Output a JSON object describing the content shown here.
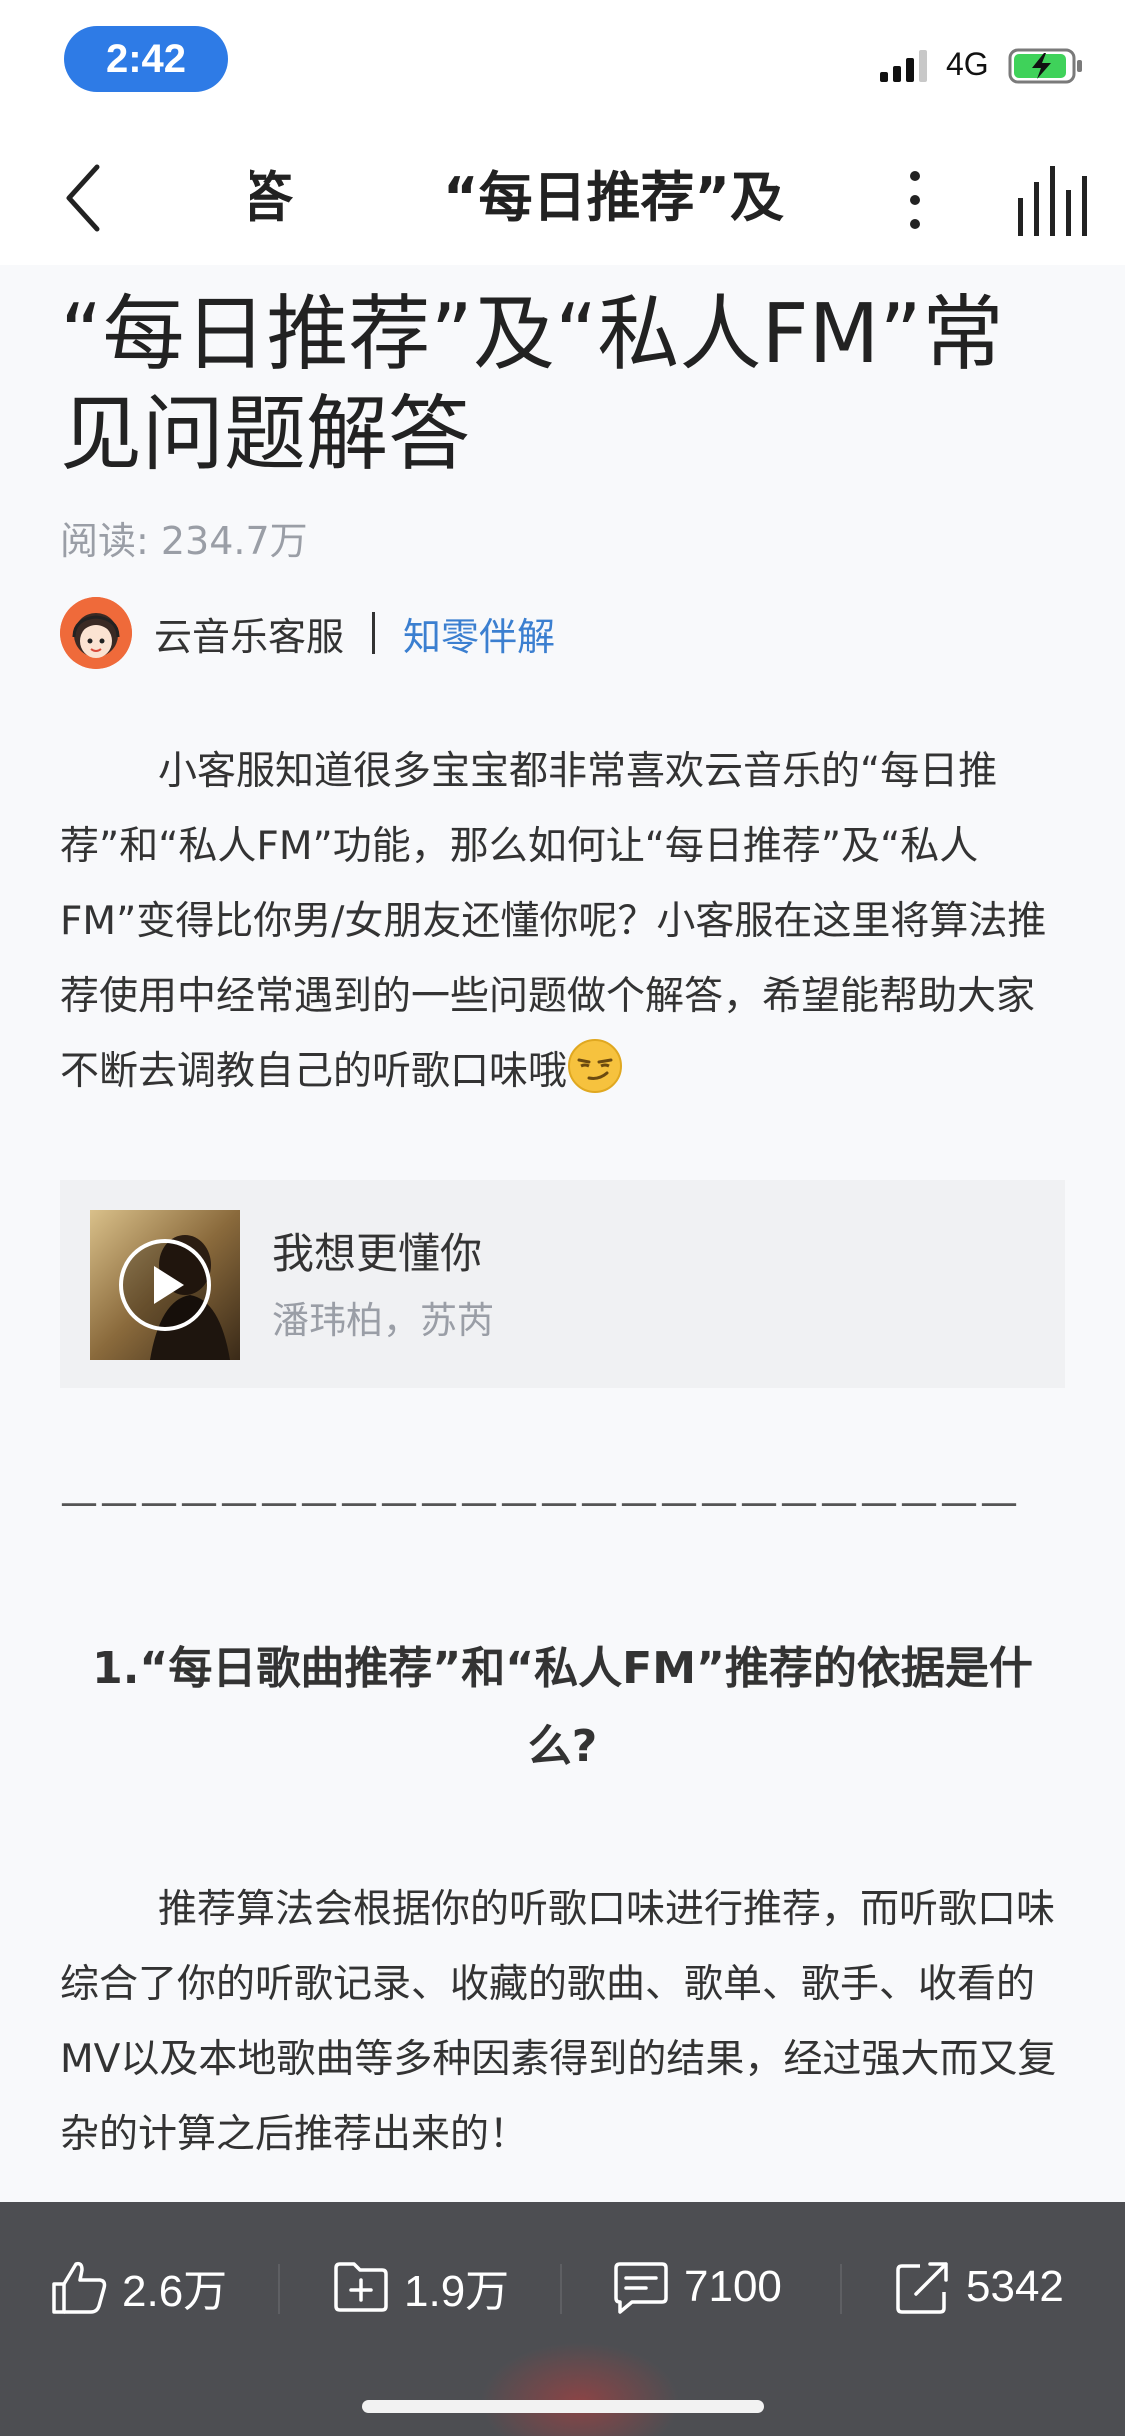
{
  "status_bar": {
    "time": "2:42",
    "network": "4G"
  },
  "nav": {
    "title_parts": [
      "解答",
      "“每日推荐”及"
    ]
  },
  "article": {
    "title": "“每日推荐”及“私人FM”常见问题解答",
    "read_count": "阅读: 234.7万",
    "author_name": "云音乐客服",
    "column_link": "知零伴解",
    "intro": "小客服知道很多宝宝都非常喜欢云音乐的“每日推荐”和“私人FM”功能，那么如何让“每日推荐”及“私人FM”变得比你男/女朋友还懂你呢？小客服在这里将算法推荐使用中经常遇到的一些问题做个解答，希望能帮助大家不断去调教自己的听歌口味哦",
    "music": {
      "title": "我想更懂你",
      "artist": "潘玮柏，苏芮"
    },
    "divider": "————————————————————————",
    "section_1_heading": "1.“每日歌曲推荐”和“私人FM”推荐的依据是什么?",
    "section_1_body": "推荐算法会根据你的听歌口味进行推荐，而听歌口味综合了你的听歌记录、收藏的歌曲、歌单、歌手、收看的MV以及本地歌曲等多种因素得到的结果，经过强大而又复杂的计算之后推荐出来的！"
  },
  "actions": {
    "like_count": "2.6万",
    "collect_count": "1.9万",
    "comment_count": "7100",
    "share_count": "5342"
  },
  "colors": {
    "accent": "#2e7be6",
    "link": "#3b7fd0",
    "bottom_bar": "#4d4e52"
  }
}
